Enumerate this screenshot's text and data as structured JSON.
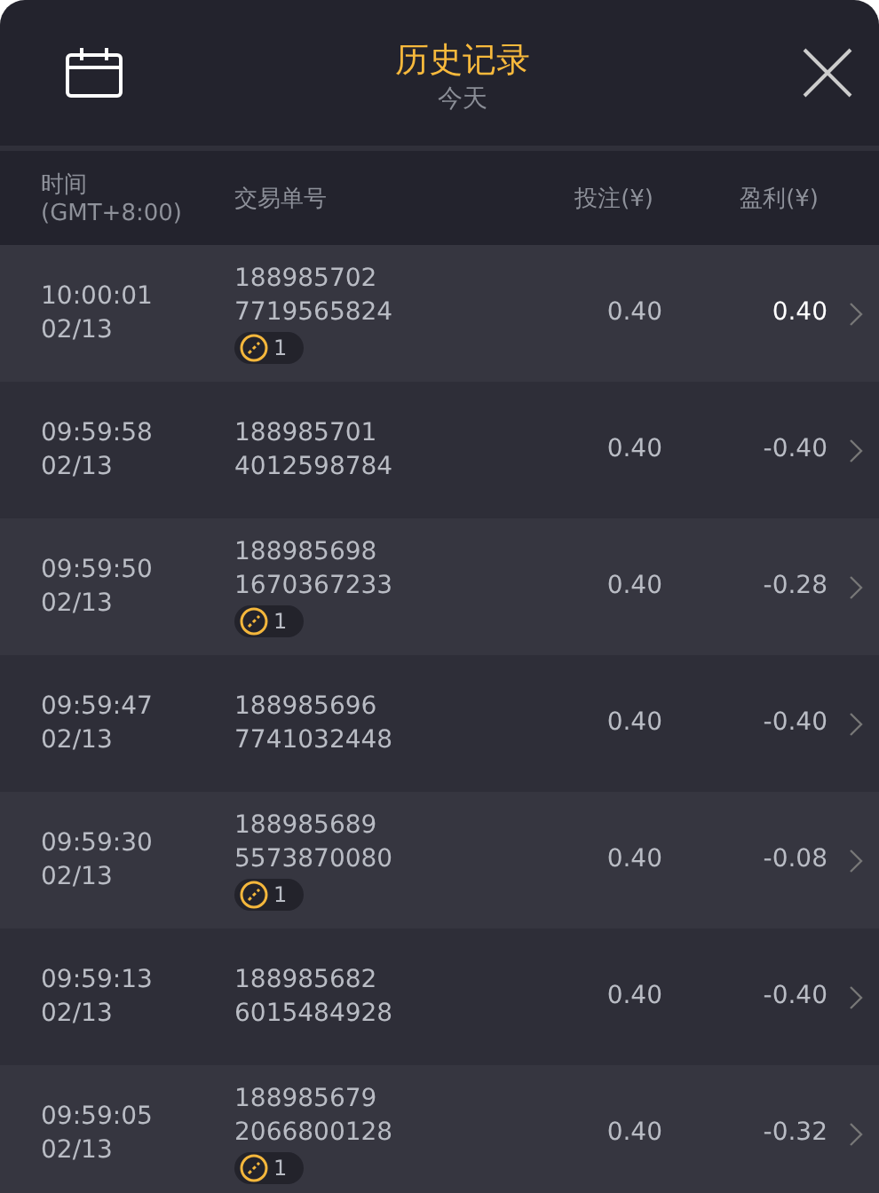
{
  "header": {
    "title": "历史记录",
    "subtitle": "今天"
  },
  "columns": [
    {
      "line1": "时间",
      "line2": "(GMT+8:00)"
    },
    {
      "line1": "交易单号"
    },
    {
      "line1": "投注(¥)"
    },
    {
      "line1": "盈利(¥)"
    }
  ],
  "rows": [
    {
      "time": "10:00:01",
      "date": "02/13",
      "id1": "188985702",
      "id2": "7719565824",
      "badge": "1",
      "bet": "0.40",
      "profit": "0.40",
      "win": true
    },
    {
      "time": "09:59:58",
      "date": "02/13",
      "id1": "188985701",
      "id2": "4012598784",
      "bet": "0.40",
      "profit": "-0.40",
      "win": false
    },
    {
      "time": "09:59:50",
      "date": "02/13",
      "id1": "188985698",
      "id2": "1670367233",
      "badge": "1",
      "bet": "0.40",
      "profit": "-0.28",
      "win": false
    },
    {
      "time": "09:59:47",
      "date": "02/13",
      "id1": "188985696",
      "id2": "7741032448",
      "bet": "0.40",
      "profit": "-0.40",
      "win": false
    },
    {
      "time": "09:59:30",
      "date": "02/13",
      "id1": "188985689",
      "id2": "5573870080",
      "badge": "1",
      "bet": "0.40",
      "profit": "-0.08",
      "win": false
    },
    {
      "time": "09:59:13",
      "date": "02/13",
      "id1": "188985682",
      "id2": "6015484928",
      "bet": "0.40",
      "profit": "-0.40",
      "win": false
    },
    {
      "time": "09:59:05",
      "date": "02/13",
      "id1": "188985679",
      "id2": "2066800128",
      "badge": "1",
      "bet": "0.40",
      "profit": "-0.32",
      "win": false
    }
  ]
}
